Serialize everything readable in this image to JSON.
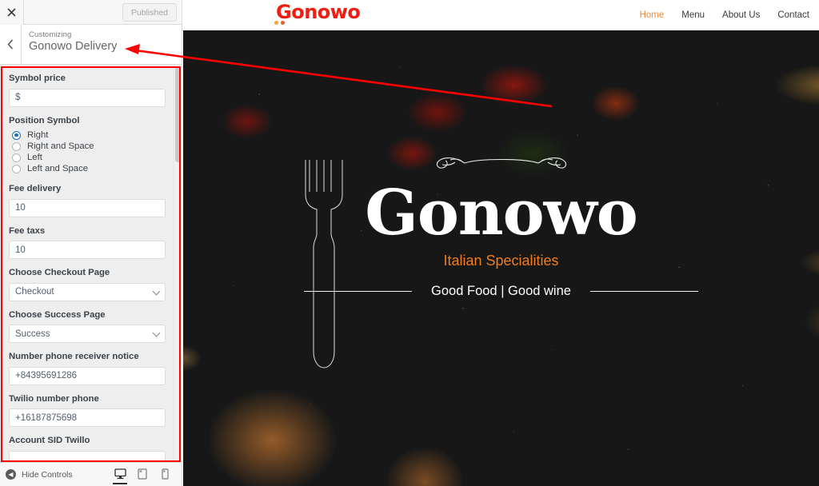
{
  "customizer": {
    "close_icon": "close-icon",
    "publish_label": "Published",
    "back_icon": "chevron-left-icon",
    "subtitle": "Customizing",
    "title": "Gonowo Delivery",
    "hide_controls_label": "Hide Controls",
    "hide_controls_icon": "collapse-left-icon",
    "devices": [
      {
        "name": "desktop",
        "icon": "desktop-icon",
        "active": true
      },
      {
        "name": "tablet",
        "icon": "tablet-icon",
        "active": false
      },
      {
        "name": "mobile",
        "icon": "mobile-icon",
        "active": false
      }
    ],
    "fields": {
      "symbol_price_label": "Symbol price",
      "symbol_price_value": "$",
      "position_symbol_label": "Position Symbol",
      "position_symbol_options": [
        {
          "label": "Right",
          "checked": true
        },
        {
          "label": "Right and Space",
          "checked": false
        },
        {
          "label": "Left",
          "checked": false
        },
        {
          "label": "Left and Space",
          "checked": false
        }
      ],
      "fee_delivery_label": "Fee delivery",
      "fee_delivery_value": "10",
      "fee_taxes_label": "Fee taxs",
      "fee_taxes_value": "10",
      "checkout_page_label": "Choose Checkout Page",
      "checkout_page_value": "Checkout",
      "success_page_label": "Choose Success Page",
      "success_page_value": "Success",
      "receiver_phone_label": "Number phone receiver notice",
      "receiver_phone_value": "+84395691286",
      "twilio_phone_label": "Twilio number phone",
      "twilio_phone_value": "+16187875698",
      "account_sid_label": "Account SID Twillo",
      "account_sid_value": ""
    }
  },
  "site": {
    "logo_text": "Gonowo",
    "nav": [
      {
        "label": "Home",
        "active": true
      },
      {
        "label": "Menu",
        "active": false
      },
      {
        "label": "About Us",
        "active": false
      },
      {
        "label": "Contact",
        "active": false
      }
    ],
    "hero": {
      "ornament_icon": "flourish-divider-icon",
      "title": "Gonowo",
      "subtitle": "Italian Specialities",
      "tagline": "Good Food | Good wine",
      "fork_icon": "fork-outline-icon"
    }
  },
  "annotation": {
    "color": "#ff0000",
    "arrow_icon": "arrow-left-icon"
  }
}
